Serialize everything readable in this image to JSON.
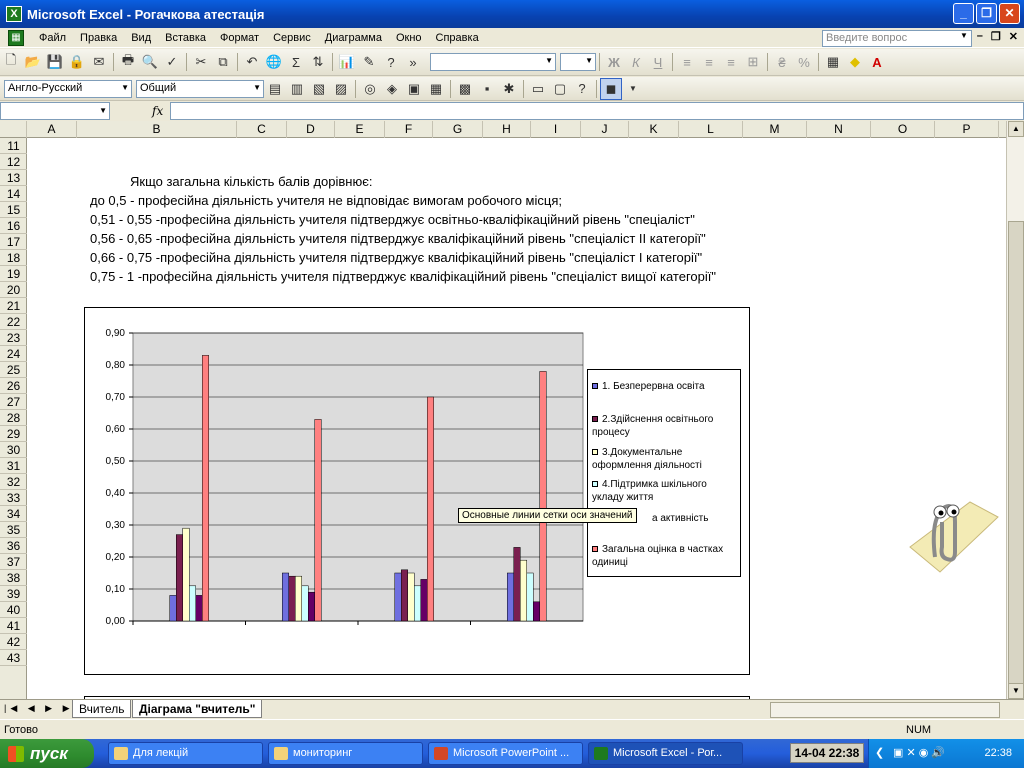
{
  "window": {
    "title": "Microsoft Excel - Рогачкова атестація"
  },
  "menu": [
    "Файл",
    "Правка",
    "Вид",
    "Вставка",
    "Формат",
    "Сервис",
    "Диаграмма",
    "Окно",
    "Справка"
  ],
  "ask_placeholder": "Введите вопрос",
  "toolbar2": {
    "language": "Англо-Русский",
    "format": "Общий"
  },
  "formula_bar": {
    "fx": "fx"
  },
  "columns": [
    "A",
    "B",
    "C",
    "D",
    "E",
    "F",
    "G",
    "H",
    "I",
    "J",
    "K",
    "L",
    "M",
    "N",
    "O",
    "P"
  ],
  "rows": [
    "11",
    "12",
    "13",
    "14",
    "15",
    "16",
    "17",
    "18",
    "19",
    "20",
    "21",
    "22",
    "23",
    "24",
    "25",
    "26",
    "27",
    "28",
    "29",
    "30",
    "31",
    "32",
    "33",
    "34",
    "35",
    "36",
    "37",
    "38",
    "39",
    "40",
    "41",
    "42",
    "43"
  ],
  "text": {
    "line13": "Якщо загальна кількість балів дорівнює:",
    "line14": "до 0,5 - професійна діяльність учителя не відповідає вимогам робочого місця;",
    "line15": "0,51 - 0,55 -професійна діяльність учителя підтверджує освітньо-кваліфікаційний рівень \"спеціаліст\"",
    "line16": "0,56 - 0,65 -професійна діяльність учителя підтверджує кваліфікаційний рівень \"спеціаліст ІІ категорії\"",
    "line17": "0,66 - 0,75 -професійна діяльність учителя підтверджує кваліфікаційний рівень \"спеціаліст І категорії\"",
    "line18": "0,75 - 1 -професійна діяльність учителя підтверджує кваліфікаційний рівень \"спеціаліст вищої категорії\""
  },
  "chart_data": {
    "type": "bar",
    "categories": [
      "",
      "",
      "",
      ""
    ],
    "ylim": [
      0,
      0.9
    ],
    "yticks": [
      "0,00",
      "0,10",
      "0,20",
      "0,30",
      "0,40",
      "0,50",
      "0,60",
      "0,70",
      "0,80",
      "0,90"
    ],
    "grid": true,
    "legend_position": "right",
    "series": [
      {
        "name": "1. Безперервна освіта",
        "color": "#6F6FE0",
        "values": [
          0.08,
          0.15,
          0.15,
          0.15
        ]
      },
      {
        "name": "2.Здійснення освітнього процесу",
        "color": "#7A1F4F",
        "values": [
          0.27,
          0.14,
          0.16,
          0.23
        ]
      },
      {
        "name": "3.Документальне оформлення діяльності",
        "color": "#FFFFCC",
        "values": [
          0.29,
          0.14,
          0.15,
          0.19
        ]
      },
      {
        "name": "4.Підтримка шкільного укладу життя",
        "color": "#CCFFFF",
        "values": [
          0.11,
          0.11,
          0.11,
          0.15
        ]
      },
      {
        "name": "",
        "color": "#660066",
        "values": [
          0.08,
          0.09,
          0.13,
          0.06
        ]
      },
      {
        "name": "Загальна оцінка в частках одиниці",
        "color": "#FF8080",
        "values": [
          0.83,
          0.63,
          0.7,
          0.78
        ]
      }
    ],
    "legend_partial_text": "а активність"
  },
  "tooltip": "Основные линии сетки оси значений",
  "sheets": [
    "Вчитель",
    "Діаграма \"вчитель\""
  ],
  "status": {
    "ready": "Готово",
    "num": "NUM"
  },
  "taskbar": {
    "start": "пуск",
    "tasks": [
      "Для лекцій",
      "мониторинг",
      "Microsoft PowerPoint ...",
      "Microsoft Excel - Рог..."
    ],
    "date": "14-04 22:38",
    "clock": "22:38"
  }
}
